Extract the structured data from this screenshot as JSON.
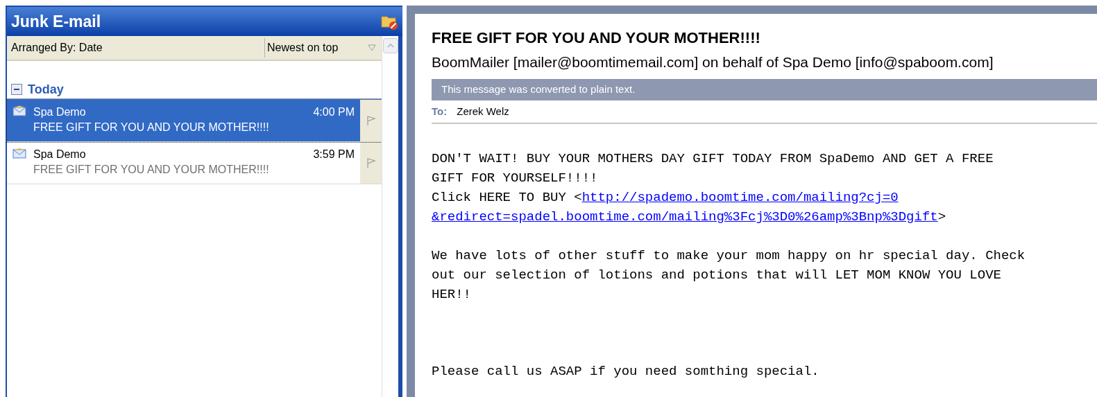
{
  "folder": {
    "title": "Junk E-mail"
  },
  "arrange": {
    "label": "Arranged By: Date",
    "order": "Newest on top"
  },
  "groups": [
    {
      "label": "Today",
      "expanded": true,
      "messages": [
        {
          "sender": "Spa Demo",
          "time": "4:00 PM",
          "subject": "FREE GIFT FOR YOU AND YOUR MOTHER!!!!",
          "selected": true
        },
        {
          "sender": "Spa Demo",
          "time": "3:59 PM",
          "subject": "FREE GIFT FOR YOU AND YOUR MOTHER!!!!",
          "selected": false
        }
      ]
    }
  ],
  "reading_pane": {
    "subject": "FREE GIFT FOR YOU AND YOUR MOTHER!!!!",
    "from": "BoomMailer [mailer@boomtimemail.com] on behalf of Spa Demo [info@spaboom.com]",
    "info_bar": "This message was converted to plain text.",
    "to_label": "To:",
    "to": "Zerek Welz",
    "paragraphs": [
      {
        "lines": [
          [
            {
              "kind": "text",
              "text": "DON'T WAIT! BUY YOUR MOTHERS DAY GIFT TODAY FROM SpaDemo AND GET A FREE"
            }
          ],
          [
            {
              "kind": "text",
              "text": "GIFT FOR YOURSELF!!!!"
            }
          ],
          [
            {
              "kind": "text",
              "text": "Click HERE TO BUY <"
            },
            {
              "kind": "link",
              "text": "http://spademo.boomtime.com/mailing?cj=0"
            }
          ],
          [
            {
              "kind": "link",
              "text": "&redirect=spadel.boomtime.com/mailing%3Fcj%3D0%26amp%3Bnp%3Dgift"
            },
            {
              "kind": "text",
              "text": ">"
            }
          ]
        ]
      },
      {
        "lines": [
          [
            {
              "kind": "text",
              "text": "We have lots of other stuff to make your mom happy on hr special day. Check"
            }
          ],
          [
            {
              "kind": "text",
              "text": "out our selection of lotions and potions that will LET MOM KNOW YOU LOVE"
            }
          ],
          [
            {
              "kind": "text",
              "text": "HER!!"
            }
          ]
        ]
      },
      {
        "lines": [
          [
            {
              "kind": "text",
              "text": "Please call us ASAP if you need somthing special."
            }
          ]
        ]
      }
    ]
  }
}
